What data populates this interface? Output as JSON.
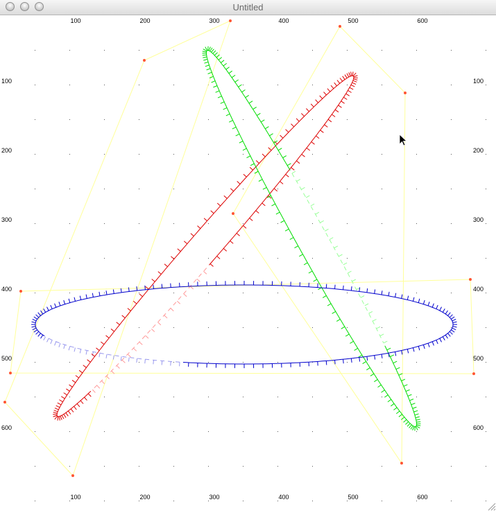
{
  "window": {
    "title": "Untitled",
    "buttons": [
      "close",
      "minimize",
      "zoom"
    ]
  },
  "axes": {
    "top_labels": [
      "100",
      "200",
      "300",
      "400",
      "500",
      "600"
    ],
    "bottom_labels": [
      "100",
      "200",
      "300",
      "400",
      "500",
      "600"
    ],
    "left_labels": [
      "100",
      "200",
      "300",
      "400",
      "500",
      "600"
    ],
    "right_labels": [
      "100",
      "200",
      "300",
      "400",
      "500",
      "600"
    ]
  },
  "colors": {
    "grid_dot": "#555555",
    "frame": "#ffff99",
    "corner": "#ff5533",
    "red": "#dd0000",
    "green": "#00dd00",
    "blue": "#0000cc",
    "red_dashed": "#ff9999",
    "green_dashed": "#99ff99",
    "blue_dashed": "#9999ee"
  },
  "cursor": {
    "icon": "arrow-cursor-icon"
  }
}
